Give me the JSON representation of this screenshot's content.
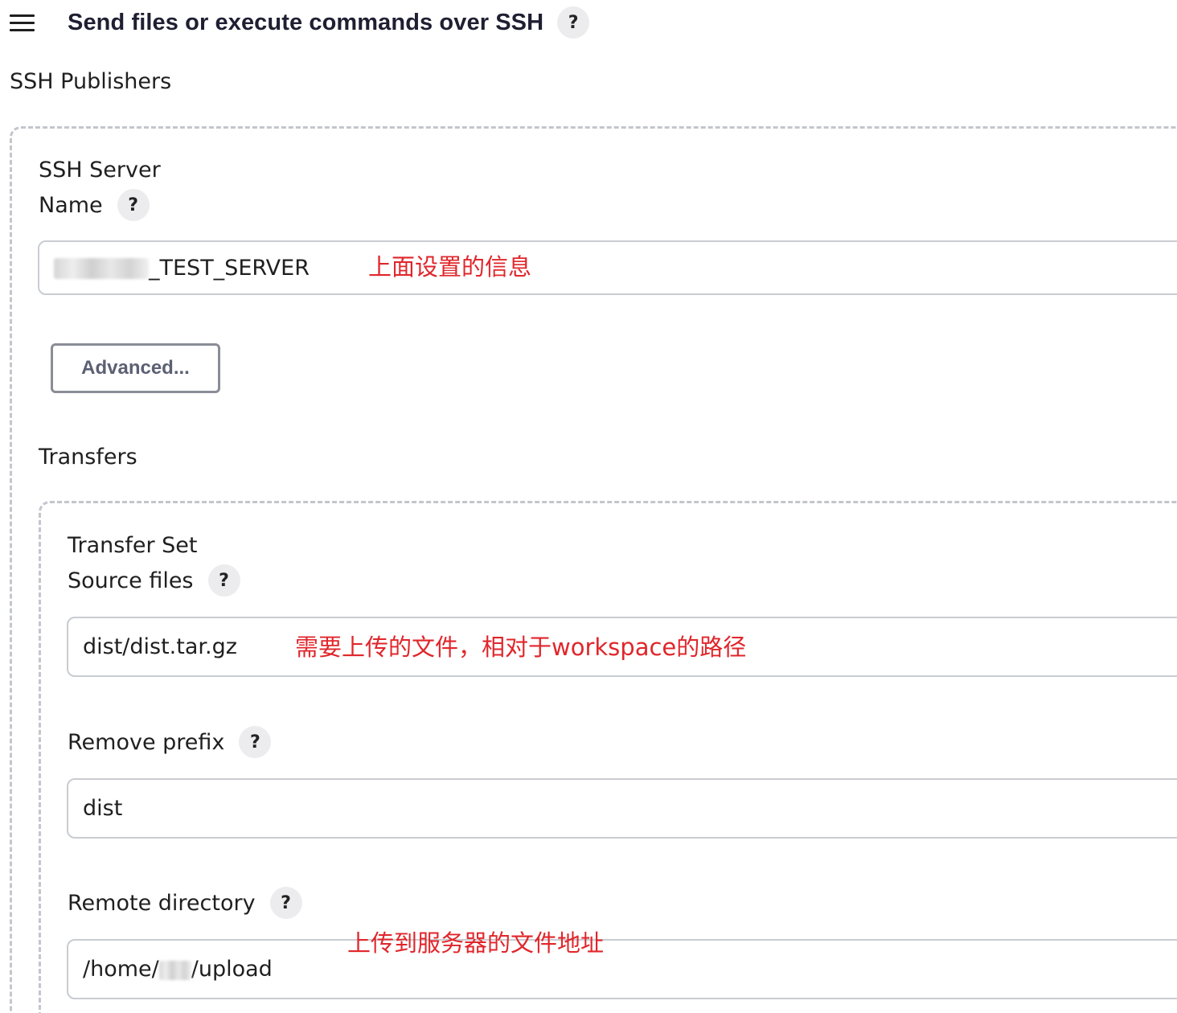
{
  "section": {
    "title": "Send files or execute commands over SSH",
    "help": "?"
  },
  "publishers_label": "SSH Publishers",
  "server": {
    "heading": "SSH Server",
    "name_label": "Name",
    "name_help": "?",
    "name_value_suffix": "_TEST_SERVER",
    "name_annotation": "上面设置的信息",
    "advanced_button": "Advanced..."
  },
  "transfers_label": "Transfers",
  "transfer_set": {
    "heading": "Transfer Set",
    "source_files_label": "Source files",
    "source_files_help": "?",
    "source_files_value": "dist/dist.tar.gz",
    "source_files_annotation": "需要上传的文件，相对于workspace的路径",
    "remove_prefix_label": "Remove prefix",
    "remove_prefix_help": "?",
    "remove_prefix_value": "dist",
    "remote_directory_label": "Remote directory",
    "remote_directory_help": "?",
    "remote_directory_prefix": "/home/",
    "remote_directory_suffix": "/upload",
    "remote_directory_annotation": "上传到服务器的文件地址"
  }
}
